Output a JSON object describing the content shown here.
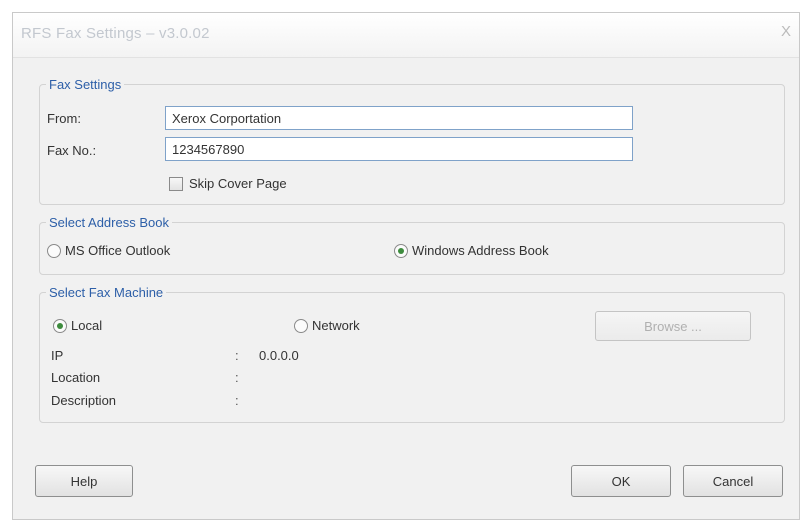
{
  "window": {
    "title": "RFS Fax Settings – v3.0.02",
    "close_label": "X"
  },
  "fax_settings": {
    "legend": "Fax Settings",
    "from_label": "From:",
    "from_value": "Xerox Corportation",
    "fax_no_label": "Fax No.:",
    "fax_no_value": "1234567890",
    "skip_cover_label": "Skip Cover Page",
    "skip_cover_checked": false
  },
  "address_book": {
    "legend": "Select Address Book",
    "options": [
      {
        "label": "MS Office Outlook",
        "checked": false
      },
      {
        "label": "Windows Address Book",
        "checked": true
      }
    ]
  },
  "fax_machine": {
    "legend": "Select Fax Machine",
    "local_label": "Local",
    "local_checked": true,
    "network_label": "Network",
    "network_checked": false,
    "browse_label": "Browse ...",
    "fields": [
      {
        "label": "IP",
        "colon": ":",
        "value": "0.0.0.0"
      },
      {
        "label": "Location",
        "colon": ":",
        "value": ""
      },
      {
        "label": "Description",
        "colon": ":",
        "value": ""
      }
    ]
  },
  "buttons": {
    "help": "Help",
    "ok": "OK",
    "cancel": "Cancel"
  }
}
